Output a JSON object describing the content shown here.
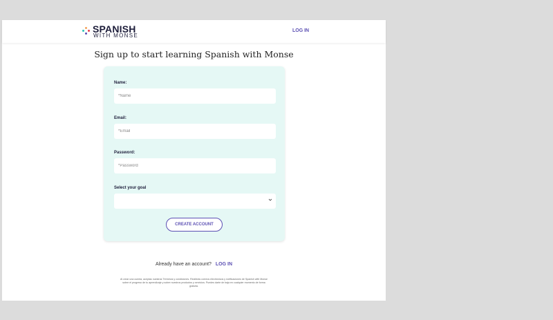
{
  "header": {
    "logo_main": "SPANISH",
    "logo_sub": "WITH MONSE",
    "login_label": "LOG IN"
  },
  "title": "Sign up to start learning Spanish with Monse",
  "form": {
    "name_label": "Name:",
    "name_placeholder": "*Name",
    "email_label": "Email:",
    "email_placeholder": "*Email",
    "password_label": "Password:",
    "password_placeholder": "*Password",
    "goal_label": "Select your goal",
    "goal_value": "",
    "submit_label": "CREATE ACCOUNT"
  },
  "footer": {
    "already_text": "Already have an account?",
    "login_label": "LOG IN",
    "terms_text": "Al crear una cuenta, aceptas nuestros Términos y condiciones. Recibirás correos electrónicos y notificaciones de Spanish with Monse sobre el progreso de tu aprendizaje y sobre nuestros productos y servicios. Puedes darte de baja en cualquier momento de forma gratuita."
  },
  "colors": {
    "accent": "#5b4fb3",
    "card_bg": "#e5f8f5",
    "logo_dots": [
      "#2ec4b6",
      "#f4a259",
      "#5b4fb3",
      "#e63946"
    ]
  },
  "icons": [
    "logo-dots-icon",
    "chevron-down-icon"
  ]
}
